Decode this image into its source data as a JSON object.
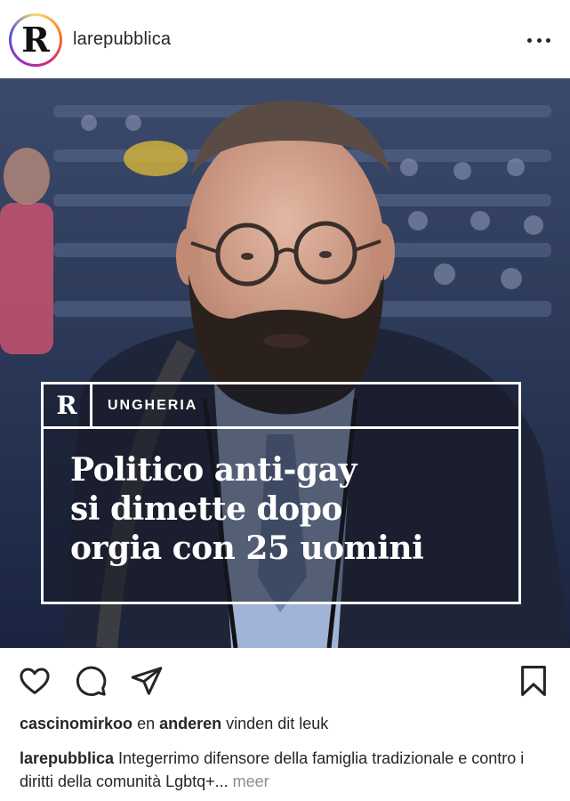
{
  "post": {
    "username": "larepubblica",
    "avatar_letter": "R",
    "image": {
      "logo_letter": "R",
      "category": "UNGHERIA",
      "headline_lines": [
        "Politico anti-gay",
        "si dimette dopo",
        "orgia con 25 uomini"
      ]
    },
    "icons": {
      "more": "more-options-icon",
      "like": "heart-icon",
      "comment": "comment-icon",
      "share": "send-icon",
      "save": "bookmark-icon"
    },
    "likes": {
      "user": "cascinomirkoo",
      "connector": "en",
      "others": "anderen",
      "suffix": "vinden dit leuk"
    },
    "caption": {
      "user": "larepubblica",
      "text": "Integerrimo difensore della famiglia tradizionale e contro i diritti della comunità Lgbtq+...",
      "more_label": "meer"
    }
  },
  "colors": {
    "text": "#262626",
    "muted": "#8e8e8e",
    "card_border": "#ffffff"
  }
}
